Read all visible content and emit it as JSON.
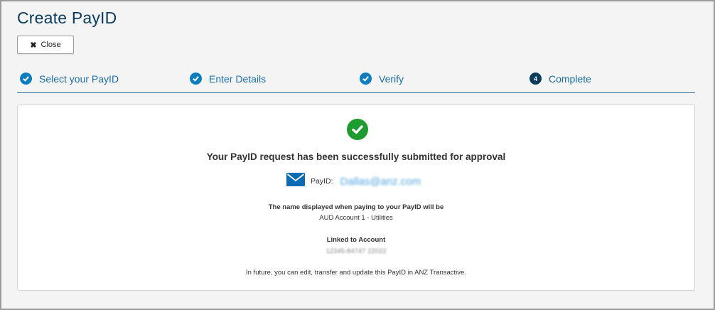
{
  "page": {
    "title": "Create PayID"
  },
  "toolbar": {
    "close_label": "Close",
    "close_icon": "close-icon"
  },
  "steps": [
    {
      "label": "Select your PayID",
      "state": "done"
    },
    {
      "label": "Enter Details",
      "state": "done"
    },
    {
      "label": "Verify",
      "state": "done"
    },
    {
      "label": "Complete",
      "state": "current",
      "number": "4"
    }
  ],
  "colors": {
    "accent": "#0c7cc0",
    "title": "#0b3c5d",
    "success": "#1f9c2f"
  },
  "result": {
    "headline": "Your PayID request has been successfully submitted for approval",
    "payid_label": "PayID:",
    "payid_value": "Dallas@anz.com",
    "display_name_heading": "The name displayed when paying to your PayID will be",
    "display_name_value": "AUD Account 1 - Utilities",
    "linked_heading": "Linked to Account",
    "linked_value": "12345-84747 22022",
    "footer_note": "In future, you can edit, transfer and update this PayID in ANZ Transactive."
  }
}
